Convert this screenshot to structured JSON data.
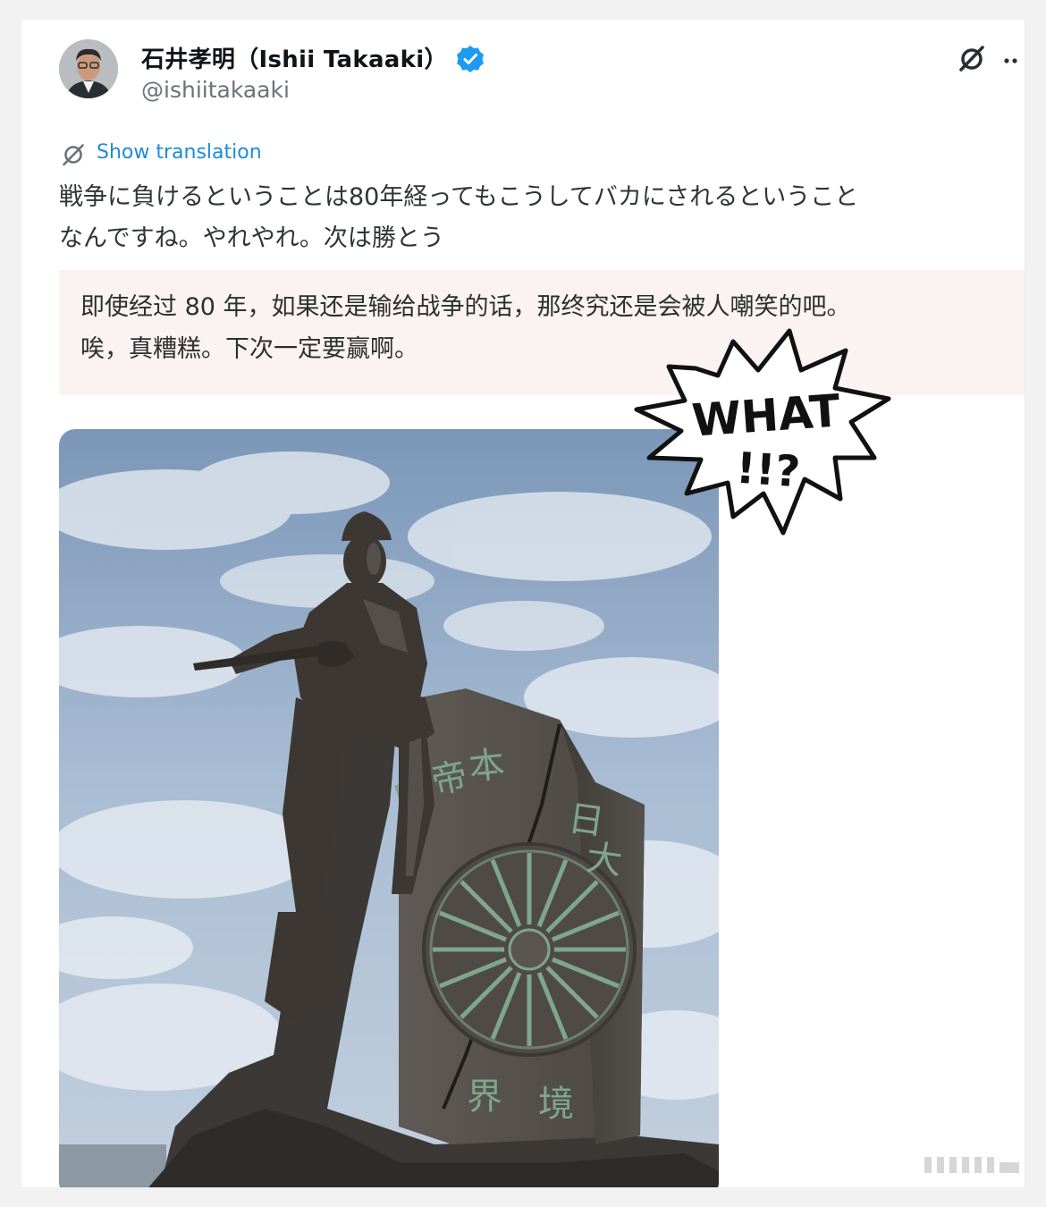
{
  "tweet": {
    "author": {
      "display_name": "石井孝明（Ishii Takaaki）",
      "handle": "@ishiitakaaki"
    },
    "icons": [
      "verified-badge-icon",
      "grok-icon",
      "more-icon",
      "translate-icon"
    ],
    "translate_label": "Show translation",
    "text_lines": [
      "戦争に負けるということは80年経ってもこうしてバカにされるということ",
      "なんですね。やれやれ。次は勝とう"
    ],
    "translation_lines": [
      "即使经过 80 年，如果还是输给战争的话，那终究还是会被人嘲笑的吧。",
      "唉，真糟糕。下次一定要赢啊。"
    ]
  },
  "overlay": {
    "burst_word": "WHAT",
    "burst_punct": "!!?"
  },
  "photo": {
    "subject": "statue-of-soldier-on-carved-boundary-stone",
    "stone_inscription_top": "大日本帝國",
    "stone_inscription_bottom": "境界"
  },
  "colors": {
    "link": "#1d8cd9",
    "verified": "#1d9bf0",
    "translation_bg": "#fbf3f1"
  }
}
